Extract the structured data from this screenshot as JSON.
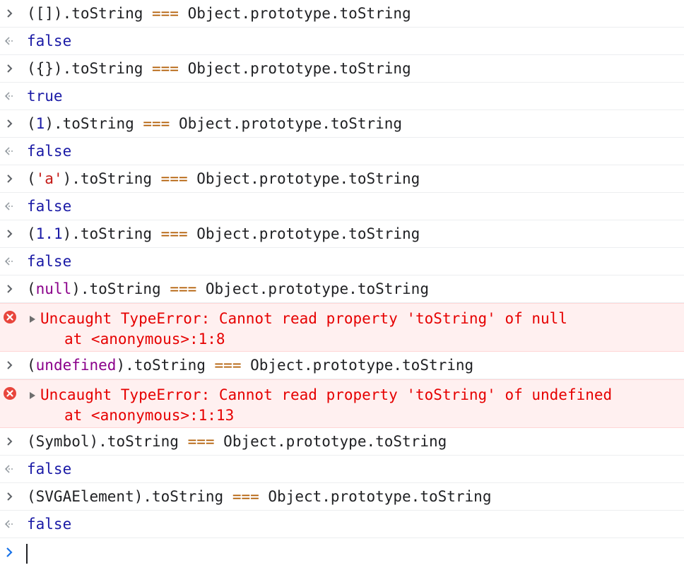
{
  "console": {
    "entries": [
      {
        "kind": "input",
        "tokens": [
          {
            "t": "([])",
            "c": "plain"
          },
          {
            "t": ".toString ",
            "c": "plain"
          },
          {
            "t": "===",
            "c": "op"
          },
          {
            "t": " Object.prototype.toString",
            "c": "plain"
          }
        ]
      },
      {
        "kind": "output",
        "value": "false"
      },
      {
        "kind": "input",
        "tokens": [
          {
            "t": "({})",
            "c": "plain"
          },
          {
            "t": ".toString ",
            "c": "plain"
          },
          {
            "t": "===",
            "c": "op"
          },
          {
            "t": " Object.prototype.toString",
            "c": "plain"
          }
        ]
      },
      {
        "kind": "output",
        "value": "true"
      },
      {
        "kind": "input",
        "tokens": [
          {
            "t": "(",
            "c": "plain"
          },
          {
            "t": "1",
            "c": "num"
          },
          {
            "t": ").toString ",
            "c": "plain"
          },
          {
            "t": "===",
            "c": "op"
          },
          {
            "t": " Object.prototype.toString",
            "c": "plain"
          }
        ]
      },
      {
        "kind": "output",
        "value": "false"
      },
      {
        "kind": "input",
        "tokens": [
          {
            "t": "(",
            "c": "plain"
          },
          {
            "t": "'a'",
            "c": "str"
          },
          {
            "t": ").toString ",
            "c": "plain"
          },
          {
            "t": "===",
            "c": "op"
          },
          {
            "t": " Object.prototype.toString",
            "c": "plain"
          }
        ]
      },
      {
        "kind": "output",
        "value": "false"
      },
      {
        "kind": "input",
        "tokens": [
          {
            "t": "(",
            "c": "plain"
          },
          {
            "t": "1.1",
            "c": "num"
          },
          {
            "t": ").toString ",
            "c": "plain"
          },
          {
            "t": "===",
            "c": "op"
          },
          {
            "t": " Object.prototype.toString",
            "c": "plain"
          }
        ]
      },
      {
        "kind": "output",
        "value": "false"
      },
      {
        "kind": "input",
        "tokens": [
          {
            "t": "(",
            "c": "plain"
          },
          {
            "t": "null",
            "c": "kw"
          },
          {
            "t": ").toString ",
            "c": "plain"
          },
          {
            "t": "===",
            "c": "op"
          },
          {
            "t": " Object.prototype.toString",
            "c": "plain"
          }
        ]
      },
      {
        "kind": "error",
        "message": "Uncaught TypeError: Cannot read property 'toString' of null",
        "stack": "at <anonymous>:1:8"
      },
      {
        "kind": "input",
        "tokens": [
          {
            "t": "(",
            "c": "plain"
          },
          {
            "t": "undefined",
            "c": "kw"
          },
          {
            "t": ").toString ",
            "c": "plain"
          },
          {
            "t": "===",
            "c": "op"
          },
          {
            "t": " Object.prototype.toString",
            "c": "plain"
          }
        ]
      },
      {
        "kind": "error",
        "message": "Uncaught TypeError: Cannot read property 'toString' of undefined",
        "stack": "at <anonymous>:1:13"
      },
      {
        "kind": "input",
        "tokens": [
          {
            "t": "(Symbol)",
            "c": "plain"
          },
          {
            "t": ".toString ",
            "c": "plain"
          },
          {
            "t": "===",
            "c": "op"
          },
          {
            "t": " Object.prototype.toString",
            "c": "plain"
          }
        ]
      },
      {
        "kind": "output",
        "value": "false"
      },
      {
        "kind": "input",
        "tokens": [
          {
            "t": "(SVGAElement)",
            "c": "plain"
          },
          {
            "t": ".toString ",
            "c": "plain"
          },
          {
            "t": "===",
            "c": "op"
          },
          {
            "t": " Object.prototype.toString",
            "c": "plain"
          }
        ]
      },
      {
        "kind": "output",
        "value": "false"
      }
    ],
    "prompt_value": ""
  },
  "icons": {
    "input_prompt": "chevron-right-icon",
    "output_result": "return-arrow-icon",
    "error": "error-circle-icon",
    "expand": "expand-triangle-icon"
  },
  "colors": {
    "operator": "#b15b00",
    "number": "#1a1aa6",
    "string": "#c41a16",
    "keyword": "#8a008a",
    "boolean": "#1a1aa6",
    "error_text": "#e60000",
    "error_bg": "#fff0f0",
    "prompt_active": "#1a73e8"
  }
}
